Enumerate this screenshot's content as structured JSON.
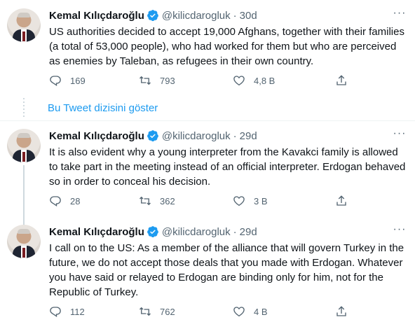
{
  "tweets": [
    {
      "name": "Kemal Kılıçdaroğlu",
      "handle": "@kilicdarogluk",
      "separator": "·",
      "time": "30d",
      "text": "US authorities decided to accept 19,000 Afghans, together with their families (a total of 53,000 people), who had worked for them but who are perceived as enemies by Taleban, as refugees in their own country.",
      "replies": "169",
      "retweets": "793",
      "likes": "4,8 B"
    },
    {
      "name": "Kemal Kılıçdaroğlu",
      "handle": "@kilicdarogluk",
      "separator": "·",
      "time": "29d",
      "text": "It is also evident why a young interpreter from the Kavakci family is allowed to take part in the meeting instead of an official interpreter. Erdogan behaved so in order to conceal his decision.",
      "replies": "28",
      "retweets": "362",
      "likes": "3 B"
    },
    {
      "name": "Kemal Kılıçdaroğlu",
      "handle": "@kilicdarogluk",
      "separator": "·",
      "time": "29d",
      "text": "I call on to the US: As a member of the alliance that will govern Turkey in the future, we do not accept those deals that you made with Erdogan. Whatever you have said or relayed to Erdogan are binding only for him, not for the Republic of Turkey.",
      "replies": "112",
      "retweets": "762",
      "likes": "4 B"
    }
  ],
  "show_thread_label": "Bu Tweet dizisini göster",
  "icons": {
    "reply": "reply-icon",
    "retweet": "retweet-icon",
    "like": "heart-icon",
    "share": "share-icon",
    "verified": "verified-badge-icon",
    "more": "more-options-icon"
  },
  "colors": {
    "accent": "#1d9bf0",
    "secondary_text": "#536471",
    "primary_text": "#0f1419",
    "divider": "#eff3f4"
  }
}
